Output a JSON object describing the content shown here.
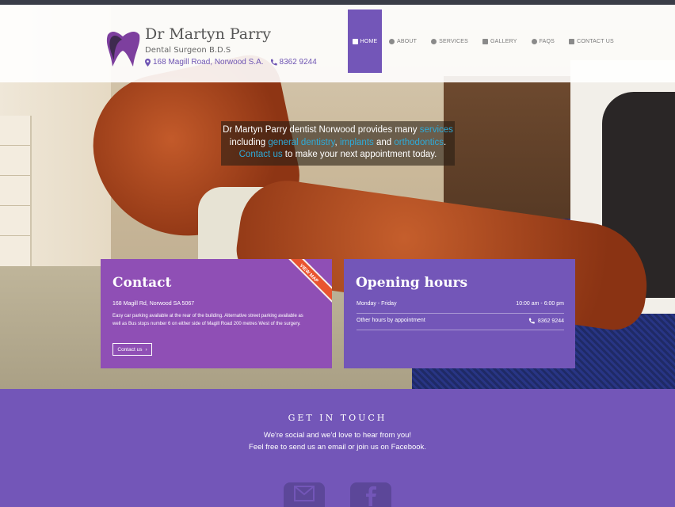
{
  "header": {
    "brand_name": "Dr Martyn Parry",
    "brand_subtitle": "Dental Surgeon B.D.S",
    "address": "168 Magill Road, Norwood S.A.",
    "phone": "8362 9244",
    "icons": {
      "location": "map-pin-icon",
      "phone": "phone-icon"
    }
  },
  "nav": {
    "items": [
      {
        "label": "Home",
        "icon": "home-icon",
        "active": true
      },
      {
        "label": "About",
        "icon": "info-icon"
      },
      {
        "label": "Services",
        "icon": "gear-icon"
      },
      {
        "label": "Gallery",
        "icon": "image-icon"
      },
      {
        "label": "FAQs",
        "icon": "question-icon"
      },
      {
        "label": "Contact us",
        "icon": "envelope-icon"
      }
    ]
  },
  "intro": {
    "t1": "Dr Martyn Parry dentist Norwood provides many ",
    "services": "services",
    "t2": "including ",
    "general": "general dentistry",
    "comma": ", ",
    "implants": "implants",
    "and": " and ",
    "ortho": "orthodontics",
    "dot": ".",
    "contact": "Contact us",
    "t3": " to make your next appointment today."
  },
  "contact_card": {
    "title": "Contact",
    "address": "168 Magill Rd, Norwood SA 5067",
    "parking": "Easy car parking available at the rear of the building. Alternative street parking available as well as Bus stops number 6 on either side of Magill Road 200 metres West of the surgery.",
    "button": "Contact us",
    "ribbon": "VIEW MAP"
  },
  "hours_card": {
    "title": "Opening hours",
    "rows": [
      {
        "label": "Monday - Friday",
        "value": "10:00 am - 6:00 pm"
      },
      {
        "label": "Other hours by appointment",
        "value": "8362 9244"
      }
    ]
  },
  "footer": {
    "title": "GET IN TOUCH",
    "line1": "We're social and we'd love to hear from you!",
    "line2": "Feel free to send us an email or join us on Facebook.",
    "icons": [
      "email-icon",
      "facebook-icon"
    ]
  },
  "colors": {
    "purple": "#7356b8",
    "magenta": "#8f4fb5",
    "link": "#2eaad8",
    "ribbon": "#e9542f"
  }
}
